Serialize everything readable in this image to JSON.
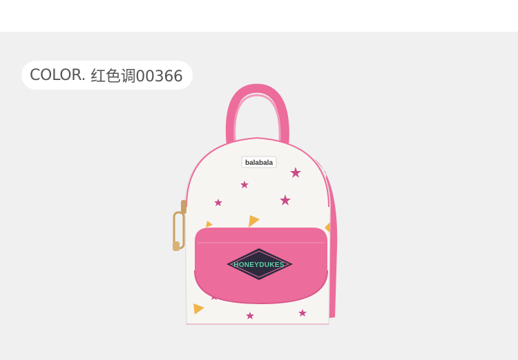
{
  "color_label": {
    "prefix": "COLOR.",
    "value": "红色调00366"
  },
  "product": {
    "brand_label": "balabala",
    "flap_badge": "HONEYDUKES",
    "colors": {
      "body": "#f7f5f2",
      "pink": "#ec6c9c",
      "pink_dark": "#d8588a",
      "badge_bg": "#2d2a3e",
      "badge_text": "#5fd0a8"
    }
  }
}
